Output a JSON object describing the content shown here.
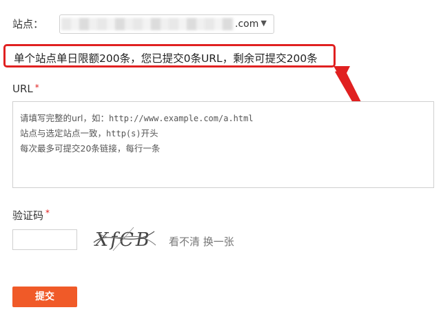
{
  "site": {
    "label": "站点：",
    "selected_value": ".com",
    "caret": "▼"
  },
  "limit_notice": "单个站点单日限额200条，您已提交0条URL，剩余可提交200条",
  "url_field": {
    "label": "URL",
    "required_mark": "*",
    "placeholder_lines": {
      "line1_prefix": "请填写完整的url，如：",
      "line1_example": "http://www.example.com/a.html",
      "line2_prefix": "站点与选定站点一致，",
      "line2_code": "http(s)",
      "line2_suffix": "开头",
      "line3": "每次最多可提交20条链接，每行一条"
    }
  },
  "captcha": {
    "label": "验证码",
    "required_mark": "*",
    "image_text": "XfCB",
    "refresh_text": "看不清 换一张"
  },
  "submit": {
    "label": "提交"
  },
  "colors": {
    "highlight": "#e02020",
    "submit_button": "#f05a28"
  }
}
